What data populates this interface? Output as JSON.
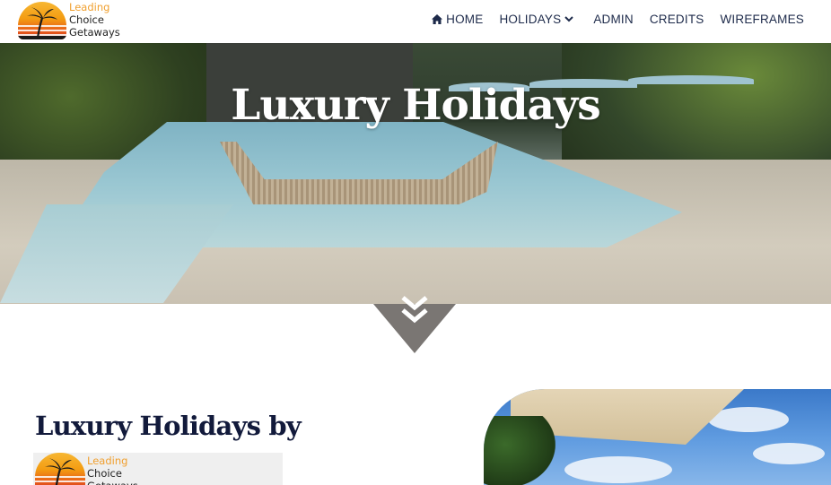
{
  "brand": {
    "line1": "Leading",
    "line2": "Choice",
    "line3": "Getaways"
  },
  "nav": {
    "items": [
      {
        "label": "HOME",
        "icon": "home-icon"
      },
      {
        "label": "HOLIDAYS",
        "icon": "chevron-down-icon"
      },
      {
        "label": "ADMIN"
      },
      {
        "label": "CREDITS"
      },
      {
        "label": "WIREFRAMES"
      }
    ]
  },
  "hero": {
    "title": "Luxury Holidays"
  },
  "scroll": {
    "icon": "double-chevron-down-icon"
  },
  "section": {
    "title": "Luxury Holidays by"
  },
  "colors": {
    "nav_text": "#1d2a4a",
    "heading": "#121a3b",
    "notch": "#7a7673",
    "brand_orange": "#f0a030"
  }
}
